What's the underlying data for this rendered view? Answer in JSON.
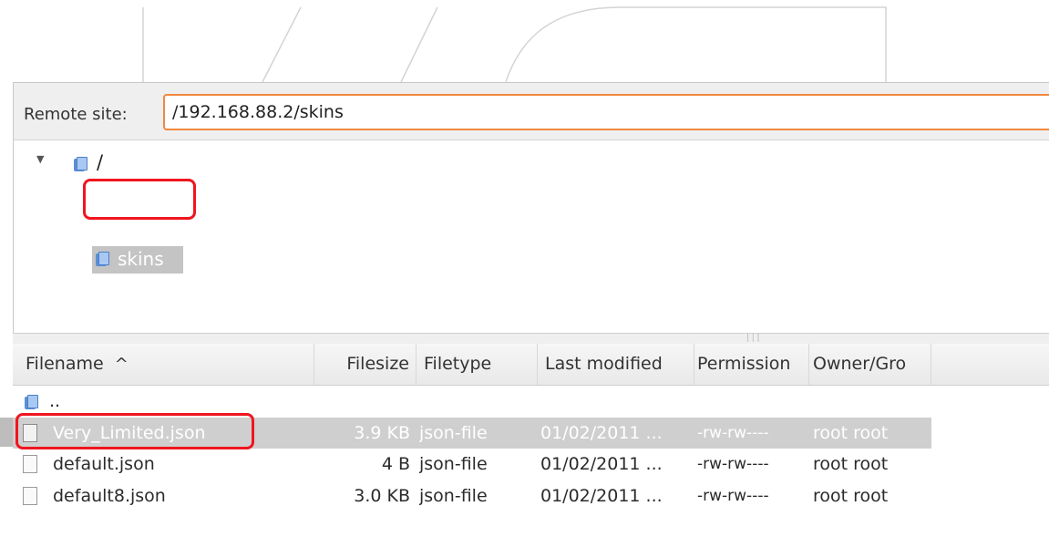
{
  "remote_site": {
    "label": "Remote site:",
    "path": "/192.168.88.2/skins"
  },
  "tree": {
    "expander_icon": "triangle-down",
    "root_label": "/",
    "child_label": "skins"
  },
  "file_list": {
    "columns": [
      "Filename",
      "Filesize",
      "Filetype",
      "Last modified",
      "Permission",
      "Owner/Gro"
    ],
    "sort_indicator": "^",
    "parent_dir_label": "..",
    "rows": [
      {
        "name": "Very_Limited.json",
        "size": "3.9 KB",
        "type": "json-file",
        "modified": "01/02/2011 ...",
        "permissions": "-rw-rw----",
        "owner": "root root",
        "selected": true
      },
      {
        "name": "default.json",
        "size": "4 B",
        "type": "json-file",
        "modified": "01/02/2011 ...",
        "permissions": "-rw-rw----",
        "owner": "root root",
        "selected": false
      },
      {
        "name": "default8.json",
        "size": "3.0 KB",
        "type": "json-file",
        "modified": "01/02/2011 ...",
        "permissions": "-rw-rw----",
        "owner": "root root",
        "selected": false
      }
    ]
  },
  "colors": {
    "highlight_annotation": "#f0151f",
    "input_focus_border": "#f0883e",
    "selection_bg": "#cfcfcf",
    "folder_blue": "#5b8fd6"
  }
}
